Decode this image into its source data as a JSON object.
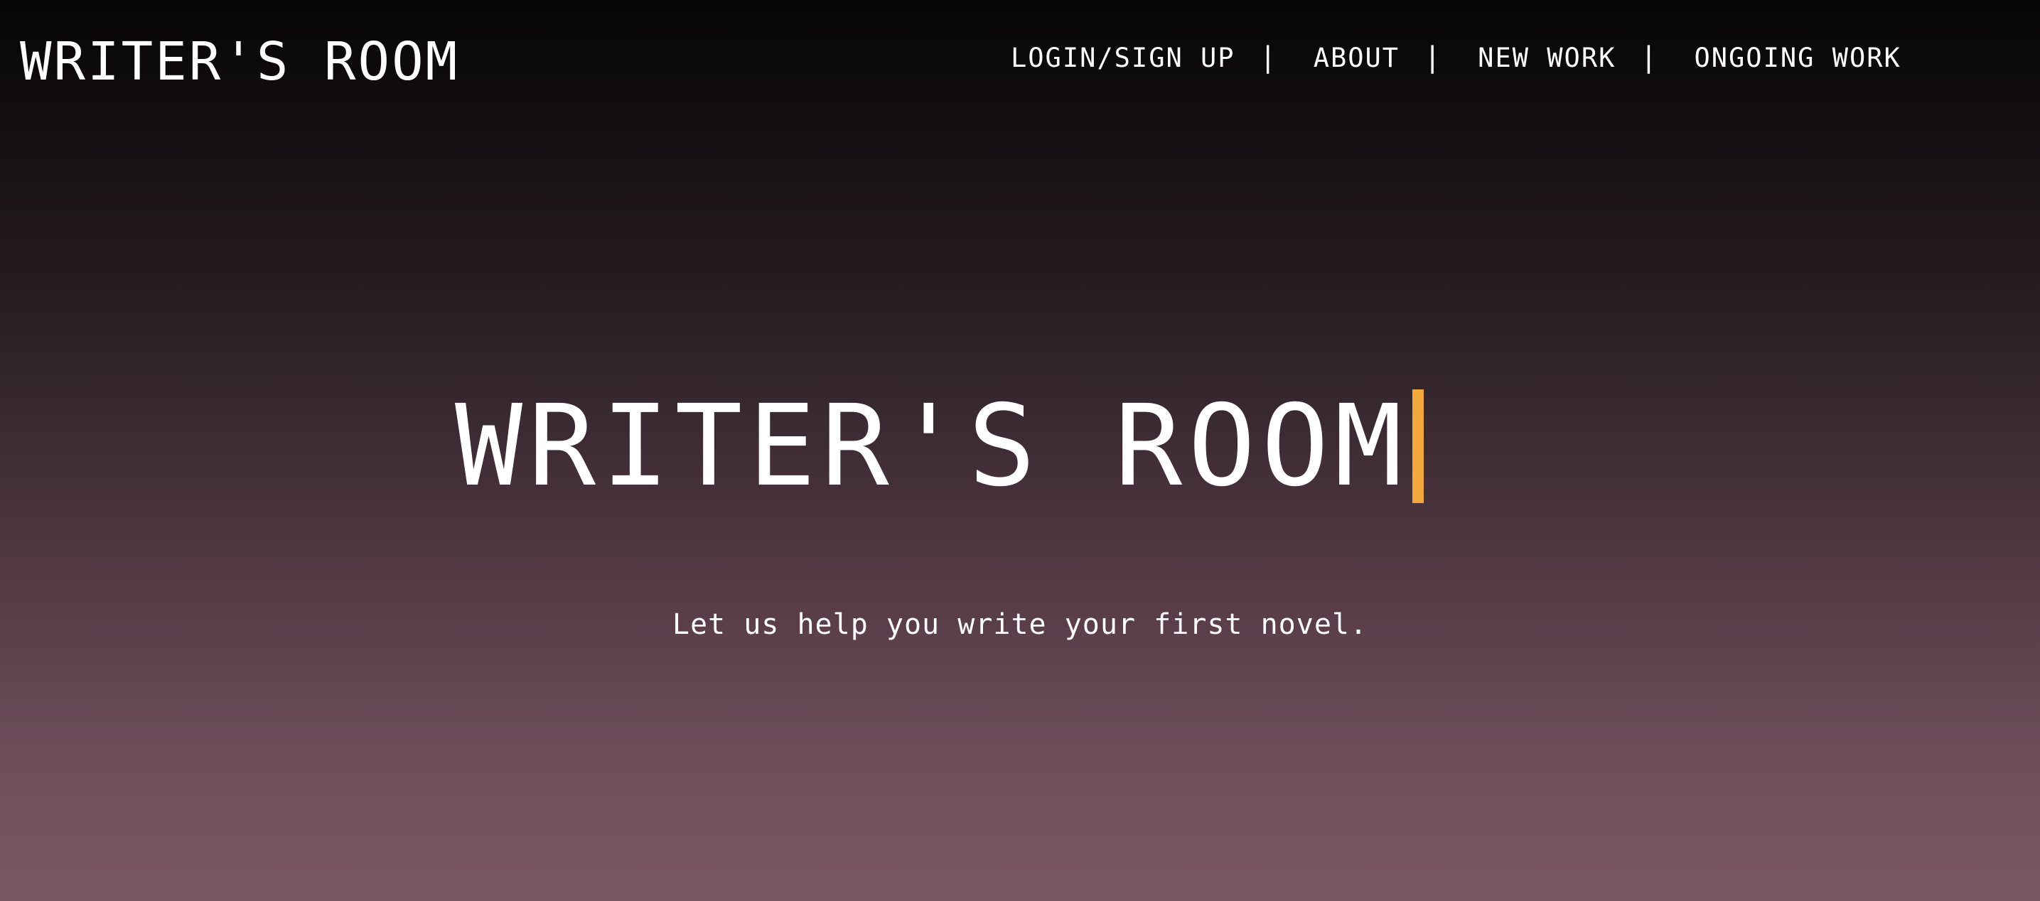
{
  "header": {
    "brand": "WRITER'S ROOM",
    "nav": [
      {
        "label": "LOGIN/SIGN UP"
      },
      {
        "label": "ABOUT"
      },
      {
        "label": "NEW WORK"
      },
      {
        "label": "ONGOING WORK"
      }
    ],
    "separator": "|"
  },
  "hero": {
    "title": "WRITER'S ROOM",
    "tagline": "Let us help you write your first novel."
  },
  "colors": {
    "cursor": "#f2a83b",
    "background_top": "#060606",
    "background_bottom": "#7b5765",
    "text": "#ffffff"
  }
}
